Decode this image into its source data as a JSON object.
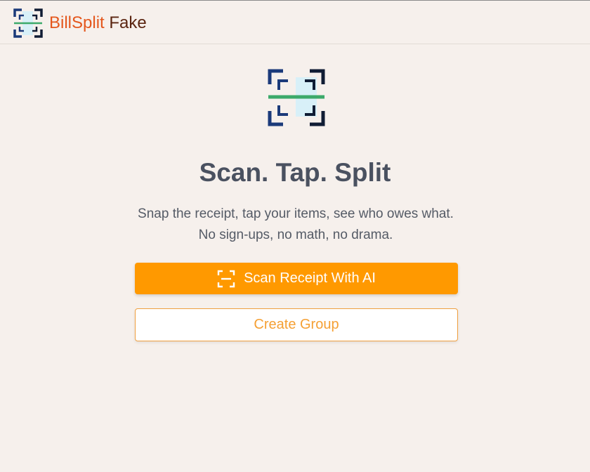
{
  "header": {
    "brand_primary": "BillSplit",
    "brand_secondary": "Fake",
    "logo_icon": "scan-frame-icon"
  },
  "hero": {
    "icon": "scan-frame-icon",
    "title": "Scan. Tap. Split",
    "subtitle": "Snap the receipt, tap your items, see who owes what. No sign-ups, no math, no drama."
  },
  "actions": {
    "scan_label": "Scan Receipt With AI",
    "scan_icon": "scan-icon",
    "create_label": "Create Group"
  },
  "colors": {
    "background": "#f6f0ec",
    "brand_orange": "#e4571d",
    "brand_brown": "#5a2410",
    "primary_button": "#ff9900",
    "secondary_button_text": "#f5a034",
    "title_text": "#4a5160",
    "icon_navy": "#1b3a7a",
    "icon_green": "#3caa6a",
    "icon_highlight": "#d8f0f8"
  }
}
